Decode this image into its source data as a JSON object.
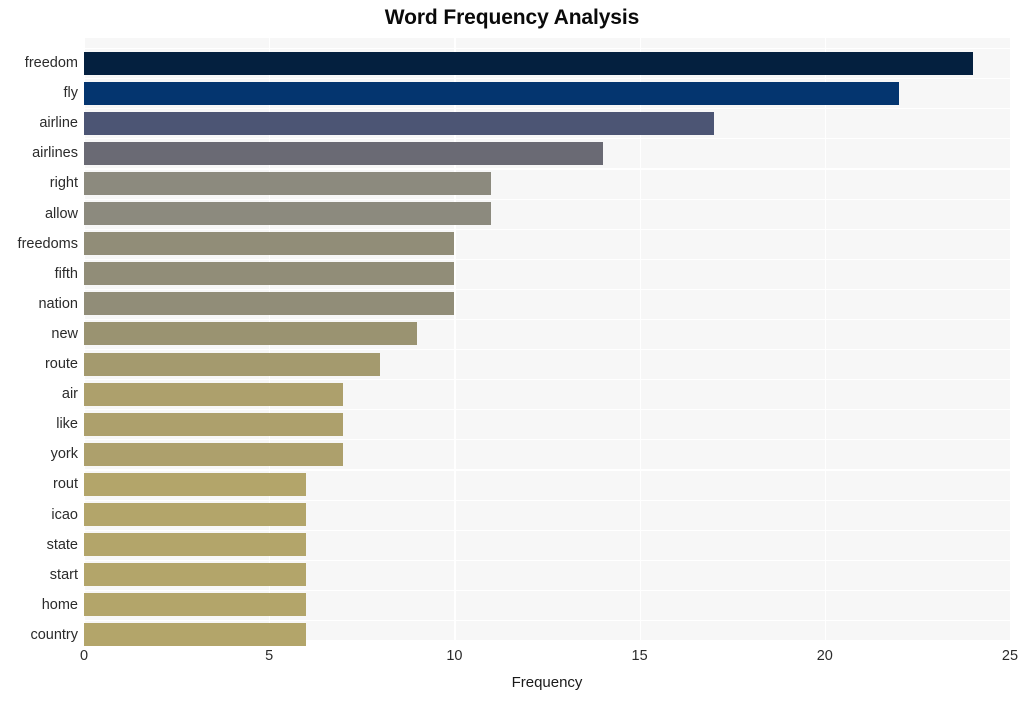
{
  "chart_data": {
    "type": "bar",
    "orientation": "horizontal",
    "title": "Word Frequency Analysis",
    "xlabel": "Frequency",
    "ylabel": "",
    "xlim": [
      0,
      25
    ],
    "xticks": [
      0,
      5,
      10,
      15,
      20,
      25
    ],
    "xtick_labels": [
      "0",
      "5",
      "10",
      "15",
      "20",
      "25"
    ],
    "grid": true,
    "legend": null,
    "categories": [
      "freedom",
      "fly",
      "airline",
      "airlines",
      "right",
      "allow",
      "freedoms",
      "fifth",
      "nation",
      "new",
      "route",
      "air",
      "like",
      "york",
      "rout",
      "icao",
      "state",
      "start",
      "home",
      "country"
    ],
    "values": [
      24,
      22,
      17,
      14,
      11,
      11,
      10,
      10,
      10,
      9,
      8,
      7,
      7,
      7,
      6,
      6,
      6,
      6,
      6,
      6
    ],
    "bar_colors": [
      "#04203f",
      "#04356f",
      "#4c5574",
      "#6a6a74",
      "#8c8a7e",
      "#8c8a7e",
      "#918d78",
      "#918d78",
      "#918d78",
      "#9a9371",
      "#a49a6e",
      "#ada06c",
      "#ada06c",
      "#ada06c",
      "#b3a56a",
      "#b3a56a",
      "#b3a56a",
      "#b3a56a",
      "#b3a56a",
      "#b3a56a"
    ],
    "plot_background": "#f7f7f7",
    "grid_color": "#ffffff",
    "figure_background": "#ffffff",
    "title_color": "#0a0a0a",
    "tick_label_color": "#2b2b2b"
  }
}
